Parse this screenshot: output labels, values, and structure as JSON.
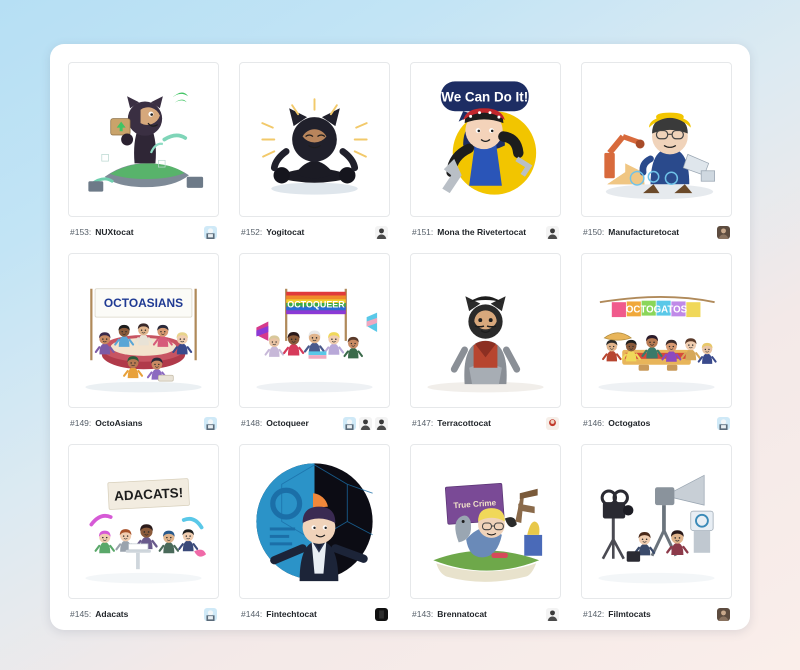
{
  "page": {
    "background_top": "#b6dff4",
    "background_bottom": "#faeeea",
    "panel_background": "#ffffff"
  },
  "gallery": {
    "name": "octodex-gallery",
    "columns": 4,
    "cards": [
      {
        "number": "#153:",
        "name": "NUXtocat",
        "art": "nuxtocat",
        "avatars": [
          "avatar-light-blue"
        ]
      },
      {
        "number": "#152:",
        "name": "Yogitocat",
        "art": "yogitocat",
        "avatars": [
          "avatar-dark"
        ]
      },
      {
        "number": "#151:",
        "name": "Mona the Rivetertocat",
        "art": "rivetertocat",
        "avatars": [
          "avatar-dark"
        ]
      },
      {
        "number": "#150:",
        "name": "Manufacturetocat",
        "art": "manufacturetocat",
        "avatars": [
          "avatar-brown"
        ]
      },
      {
        "number": "#149:",
        "name": "OctoAsians",
        "art": "octoasians",
        "avatars": [
          "avatar-light-blue"
        ]
      },
      {
        "number": "#148:",
        "name": "Octoqueer",
        "art": "octoqueer",
        "avatars": [
          "avatar-light-blue",
          "avatar-dark",
          "avatar-dark"
        ]
      },
      {
        "number": "#147:",
        "name": "Terracottocat",
        "art": "terracottocat",
        "avatars": [
          "avatar-red"
        ]
      },
      {
        "number": "#146:",
        "name": "Octogatos",
        "art": "octogatos",
        "avatars": [
          "avatar-light-blue"
        ]
      },
      {
        "number": "#145:",
        "name": "Adacats",
        "art": "adacats",
        "avatars": [
          "avatar-light-blue"
        ]
      },
      {
        "number": "#144:",
        "name": "Fintechtocat",
        "art": "fintechtocat",
        "avatars": [
          "avatar-black"
        ]
      },
      {
        "number": "#143:",
        "name": "Brennatocat",
        "art": "brennatocat",
        "avatars": [
          "avatar-dark"
        ]
      },
      {
        "number": "#142:",
        "name": "Filmtocats",
        "art": "filmtocats",
        "avatars": [
          "avatar-brown"
        ]
      }
    ]
  },
  "artwork_text": {
    "rivetertocat_banner": "We Can Do It!",
    "octoasians_banner": "OCTOASIANS",
    "octoqueer_banner": "OCTOQUEER",
    "octogatos_banner": "OCTOGATOS",
    "adacats_banner": "ADACATS!",
    "brennatocat_book": "True Crime"
  }
}
